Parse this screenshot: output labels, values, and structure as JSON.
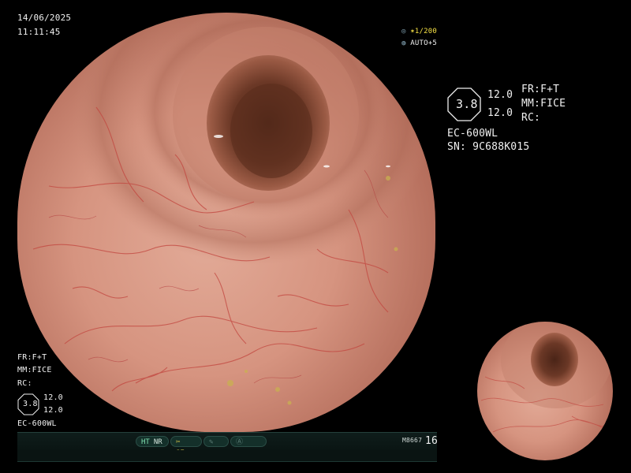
{
  "osd": {
    "date": "14/06/2025",
    "time": "11:11:45",
    "shutter": "1/200",
    "auto": "AUTO+5"
  },
  "right_panel": {
    "hex_value": "3.8",
    "value_a": "12.0",
    "value_b": "12.0",
    "fr": "FR:F+T",
    "mm": "MM:FICE",
    "rc": "RC:",
    "scope_model": "EC-600WL",
    "serial": "SN: 9C688K015"
  },
  "left_panel": {
    "fr": "FR:F+T",
    "mm": "MM:FICE",
    "rc": "RC:",
    "hex_value": "3.8",
    "value_a": "12.0",
    "value_b": "12.0",
    "scope_model": "EC-600WL"
  },
  "status_bar": {
    "ht": "HT",
    "nr": "NR",
    "se": "SE",
    "code": "M8667",
    "count": "16"
  },
  "icons": {
    "iris": "iris-icon",
    "auto": "auto-exposure-icon",
    "scissors": "scissors-icon",
    "pencil": "pencil-icon",
    "circle": "capture-icon"
  },
  "colors": {
    "mucosa": "#d79583",
    "lumen": "#5a3022",
    "vessel": "#c2463f",
    "status_text": "#7fe0b0",
    "exposure_highlight": "#f5e045"
  }
}
